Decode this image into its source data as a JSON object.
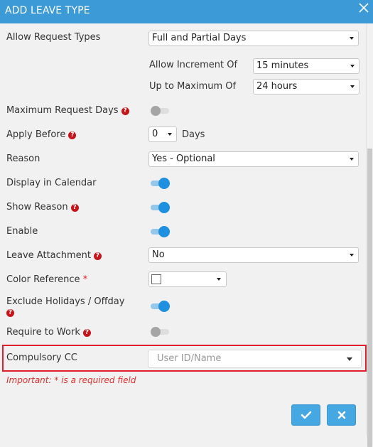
{
  "dialog": {
    "title": "ADD LEAVE TYPE",
    "close_icon": "close-icon"
  },
  "allow_request_types": {
    "label": "Allow Request Types",
    "value": "Full and Partial Days"
  },
  "allow_increment": {
    "label": "Allow Increment Of",
    "value": "15 minutes"
  },
  "up_to_maximum": {
    "label": "Up to Maximum Of",
    "value": "24 hours"
  },
  "maximum_request_days": {
    "label": "Maximum Request Days",
    "enabled": false
  },
  "apply_before": {
    "label": "Apply Before",
    "value": "0",
    "unit": "Days"
  },
  "reason": {
    "label": "Reason",
    "value": "Yes - Optional"
  },
  "display_in_calendar": {
    "label": "Display in Calendar",
    "enabled": true
  },
  "show_reason": {
    "label": "Show Reason",
    "enabled": true
  },
  "enable": {
    "label": "Enable",
    "enabled": true
  },
  "leave_attachment": {
    "label": "Leave Attachment",
    "value": "No"
  },
  "color_reference": {
    "label": "Color Reference",
    "required_mark": "*",
    "color": "#ffffff"
  },
  "exclude_holidays": {
    "label": "Exclude Holidays / Offday",
    "enabled": true
  },
  "require_to_work": {
    "label": "Require to Work",
    "enabled": false
  },
  "compulsory_cc": {
    "label": "Compulsory CC",
    "placeholder": "User ID/Name"
  },
  "important_note": "Important: * is a required field",
  "help_icon_glyph": "?",
  "buttons": {
    "confirm_icon": "check-icon",
    "cancel_icon": "close-icon"
  },
  "colors": {
    "header": "#3c9bd7",
    "accent": "#1f8fe0",
    "highlight_border": "#e0202c"
  }
}
